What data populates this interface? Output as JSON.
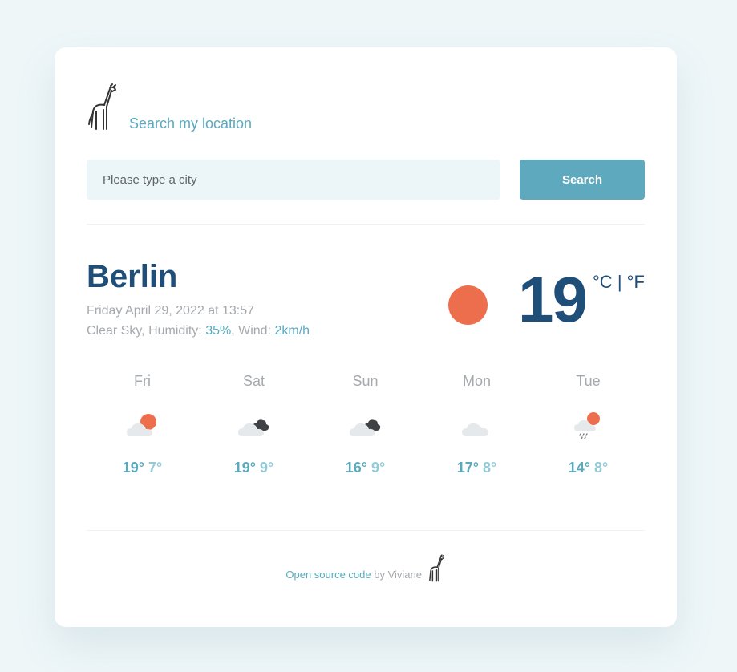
{
  "header": {
    "location_link": "Search my location"
  },
  "search": {
    "placeholder": "Please type a city",
    "value": "",
    "button_label": "Search"
  },
  "current": {
    "city": "Berlin",
    "datetime": "Friday April 29, 2022 at 13:57",
    "description": "Clear Sky",
    "humidity_label": "Humidity:",
    "humidity_value": "35%",
    "wind_label": "Wind:",
    "wind_value": "2km/h",
    "temperature": "19",
    "unit_celsius": "°C",
    "unit_separator": "|",
    "unit_fahrenheit": "°F",
    "icon": "sun-icon"
  },
  "forecast": [
    {
      "day": "Fri",
      "max": "19°",
      "min": "7°",
      "icon": "partly-sunny-icon"
    },
    {
      "day": "Sat",
      "max": "19°",
      "min": "9°",
      "icon": "cloudy-dark-icon"
    },
    {
      "day": "Sun",
      "max": "16°",
      "min": "9°",
      "icon": "cloudy-dark-icon"
    },
    {
      "day": "Mon",
      "max": "17°",
      "min": "8°",
      "icon": "cloud-icon"
    },
    {
      "day": "Tue",
      "max": "14°",
      "min": "8°",
      "icon": "sun-rain-icon"
    }
  ],
  "footer": {
    "link_text": "Open source code",
    "by_text": "by Viviane"
  },
  "colors": {
    "accent": "#5ea9bd",
    "title": "#1f4e79",
    "sun": "#ec6e4c",
    "muted": "#a5a9ad",
    "background": "#eef6f8"
  }
}
